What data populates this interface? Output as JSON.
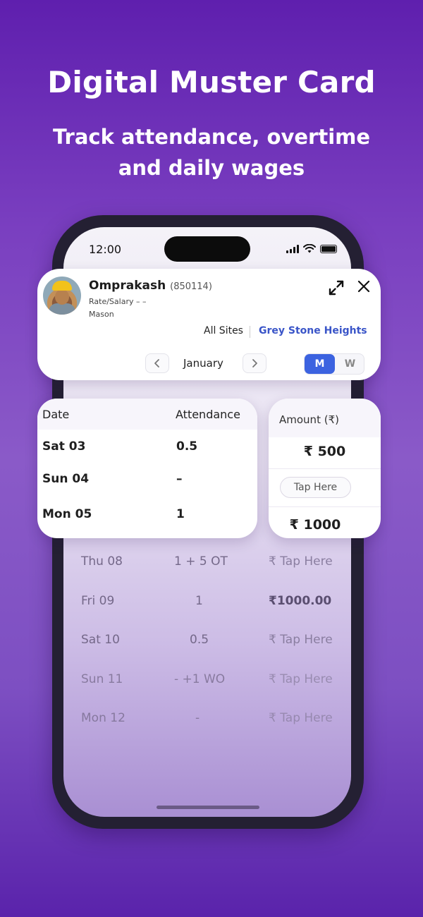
{
  "promo": {
    "title": "Digital Muster Card",
    "subtitle": "Track attendance, overtime and daily wages"
  },
  "status_bar": {
    "time": "12:00"
  },
  "worker": {
    "name": "Omprakash",
    "id": "(850114)",
    "rate_label": "Rate/Salary – –",
    "role": "Mason"
  },
  "filters": {
    "all_sites": "All Sites",
    "site": "Grey Stone Heights"
  },
  "period": {
    "month": "January",
    "mode_m": "M",
    "mode_w": "W",
    "selected_mode": "M"
  },
  "attendance_card": {
    "col_date": "Date",
    "col_attendance": "Attendance",
    "rows": [
      {
        "date": "Sat 03",
        "attendance": "0.5"
      },
      {
        "date": "Sun 04",
        "attendance": "–"
      },
      {
        "date": "Mon 05",
        "attendance": "1"
      }
    ]
  },
  "amount_card": {
    "col_amount": "Amount (₹)",
    "values": [
      "₹ 500",
      "Tap Here",
      "₹ 1000"
    ]
  },
  "background_rows": [
    {
      "date": "Thu 08",
      "attendance": "1 + 5 OT",
      "amount": "₹ Tap Here"
    },
    {
      "date": "Fri 09",
      "attendance": "1",
      "amount": "₹1000.00"
    },
    {
      "date": "Sat 10",
      "attendance": "0.5",
      "amount": "₹ Tap Here"
    },
    {
      "date": "Sun 11",
      "attendance": "- +1 WO",
      "amount": "₹ Tap Here"
    },
    {
      "date": "Mon 12",
      "attendance": "-",
      "amount": "₹ Tap Here"
    }
  ],
  "colors": {
    "accent": "#3c63e0",
    "site_link": "#3a55c8",
    "background_top": "#5f1fae"
  }
}
